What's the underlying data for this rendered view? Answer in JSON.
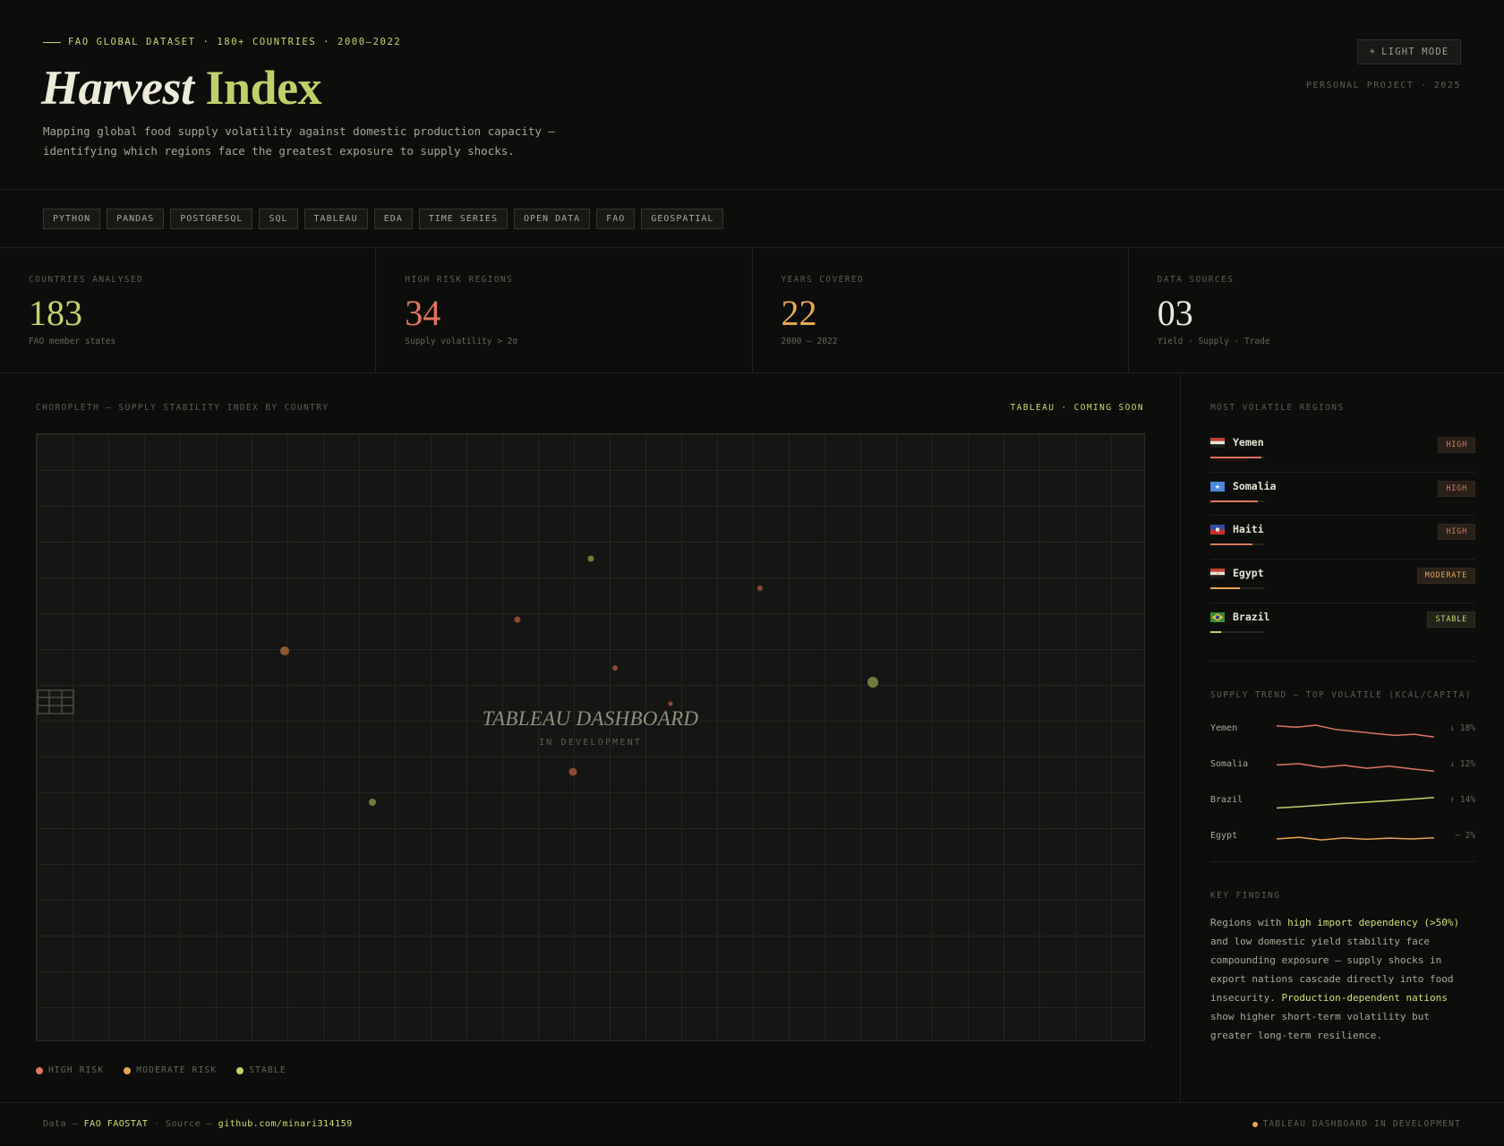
{
  "header": {
    "eyebrow": "FAO GLOBAL DATASET · 180+ COUNTRIES · 2000–2022",
    "title_italic": "Harvest",
    "title_accent": "Index",
    "subtitle": "Mapping global food supply volatility against domestic production capacity — identifying which regions face the greatest exposure to supply shocks.",
    "mode_button": "LIGHT MODE",
    "mode_icon": "☀",
    "project_meta": "PERSONAL PROJECT · 2025"
  },
  "tags": [
    "PYTHON",
    "PANDAS",
    "POSTGRESQL",
    "SQL",
    "TABLEAU",
    "EDA",
    "TIME SERIES",
    "OPEN DATA",
    "FAO",
    "GEOSPATIAL"
  ],
  "stats": [
    {
      "label": "COUNTRIES ANALYSED",
      "value": "183",
      "note": "FAO member states",
      "color": "#c2d46a"
    },
    {
      "label": "HIGH RISK REGIONS",
      "value": "34",
      "note": "Supply volatility > 2σ",
      "color": "#e07560"
    },
    {
      "label": "YEARS COVERED",
      "value": "22",
      "note": "2000 — 2022",
      "color": "#e8a653"
    },
    {
      "label": "DATA SOURCES",
      "value": "03",
      "note": "Yield · Supply · Trade",
      "color": "#ecead9"
    }
  ],
  "map": {
    "heading": "CHOROPLETH — SUPPLY STABILITY INDEX BY COUNTRY",
    "status": "TABLEAU · COMING SOON",
    "placeholder_title": "TABLEAU DASHBOARD",
    "placeholder_sub": "IN DEVELOPMENT",
    "legend": [
      {
        "label": "HIGH RISK",
        "color": "#e07560"
      },
      {
        "label": "MODERATE RISK",
        "color": "#e8a653"
      },
      {
        "label": "STABLE",
        "color": "#c2d46a"
      }
    ]
  },
  "side": {
    "volatile_heading": "MOST VOLATILE REGIONS",
    "regions": [
      {
        "name": "Yemen",
        "badge": "HIGH",
        "level": "high",
        "bar": 0.95
      },
      {
        "name": "Somalia",
        "badge": "HIGH",
        "level": "high",
        "bar": 0.88
      },
      {
        "name": "Haiti",
        "badge": "HIGH",
        "level": "high",
        "bar": 0.78
      },
      {
        "name": "Egypt",
        "badge": "MODERATE",
        "level": "mod",
        "bar": 0.55
      },
      {
        "name": "Brazil",
        "badge": "STABLE",
        "level": "stable",
        "bar": 0.2
      }
    ],
    "trend_heading": "SUPPLY TREND — TOP VOLATILE (KCAL/CAPITA)",
    "trends": [
      {
        "name": "Yemen",
        "delta": "↓ 18%",
        "color": "#e07560",
        "points": [
          0.78,
          0.72,
          0.82,
          0.6,
          0.5,
          0.4,
          0.3,
          0.36,
          0.22
        ]
      },
      {
        "name": "Somalia",
        "delta": "↓ 12%",
        "color": "#e07560",
        "points": [
          0.62,
          0.68,
          0.5,
          0.6,
          0.45,
          0.56,
          0.42,
          0.3
        ]
      },
      {
        "name": "Brazil",
        "delta": "↑ 14%",
        "color": "#c2d46a",
        "points": [
          0.25,
          0.32,
          0.4,
          0.48,
          0.55,
          0.62,
          0.7,
          0.78
        ]
      },
      {
        "name": "Egypt",
        "delta": "~ 2%",
        "color": "#e8a653",
        "points": [
          0.5,
          0.58,
          0.45,
          0.55,
          0.48,
          0.54,
          0.5,
          0.56
        ]
      }
    ],
    "finding_heading": "KEY FINDING",
    "finding": {
      "p1": "Regions with ",
      "h1": "high import dependency (>50%)",
      "p2": " and low domestic yield stability face compounding exposure — supply shocks in export nations cascade directly into food insecurity. ",
      "h2": "Production-dependent nations",
      "p3": " show higher short-term volatility but greater long-term resilience."
    }
  },
  "footer": {
    "data_label": "Data —",
    "data_value": "FAO FAOSTAT",
    "source_label": "· Source —",
    "source_value": "github.com/minari314159",
    "status": "TABLEAU DASHBOARD IN DEVELOPMENT",
    "status_color": "#e8a653"
  }
}
